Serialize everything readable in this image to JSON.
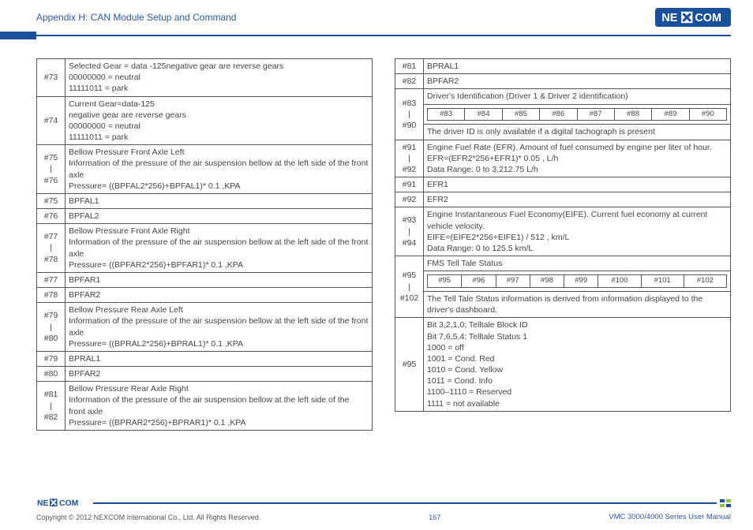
{
  "header": {
    "appendix": "Appendix H: CAN Module Setup and Command",
    "brand": "NEXCOM"
  },
  "left_rows": [
    {
      "idx": "#73",
      "desc": "Selected Gear = data -125negative gear are reverse gears\n00000000 = neutral\n11111011 = park"
    },
    {
      "idx": "#74",
      "desc": "Current Gear=data-125\nnegative gear are reverse gears\n00000000 = neutral\n11111011 = park"
    },
    {
      "idx": "#75\n|\n#76",
      "desc": "Bellow Pressure Front Axle Left\nInformation of the pressure of the air suspension bellow at the left side of the front axle\nPressure= ((BPFAL2*256)+BPFAL1)* 0.1 ,KPA"
    },
    {
      "idx": "#75",
      "desc": "BPFAL1"
    },
    {
      "idx": "#76",
      "desc": "BPFAL2"
    },
    {
      "idx": "#77\n|\n#78",
      "desc": "Bellow Pressure Front Axle Right\nInformation of the pressure of the air suspension bellow at the left side of the front axle\nPressure= ((BPFAR2*256)+BPFAR1)* 0.1 ,KPA"
    },
    {
      "idx": "#77",
      "desc": "BPFAR1"
    },
    {
      "idx": "#78",
      "desc": "BPFAR2"
    },
    {
      "idx": "#79\n|\n#80",
      "desc": "Bellow Pressure Rear Axle Left\nInformation of the pressure of the air suspension bellow at the left side of the front axle\nPressure= ((BPRAL2*256)+BPRAL1)* 0.1 ,KPA"
    },
    {
      "idx": "#79",
      "desc": "BPRAL1"
    },
    {
      "idx": "#80",
      "desc": "BPFAR2"
    },
    {
      "idx": "#81\n|\n#82",
      "desc": "Bellow Pressure Rear Axle Right\nInformation of the pressure of the air suspension bellow at the left side of the\nfront axle\nPressure= ((BPRAR2*256)+BPRAR1)* 0.1 ,KPA"
    }
  ],
  "right_rows_a": [
    {
      "idx": "#81",
      "desc": "BPRAL1"
    },
    {
      "idx": "#82",
      "desc": "BPFAR2"
    }
  ],
  "r83_idx": "#83\n|\n#90",
  "r83_title": "Driver's Identification (Driver 1 & Driver 2 identification)",
  "r83_sub": [
    "#83",
    "#84",
    "#85",
    "#86",
    "#87",
    "#88",
    "#89",
    "#90"
  ],
  "r83_note": "The driver ID is only available if a digital tachograph is present",
  "right_rows_b": [
    {
      "idx": "#91\n|\n#92",
      "desc": "Engine Fuel Rate (EFR). Amount of fuel consumed by engine per liter of hour.\nEFR=(EFR2*256+EFR1)* 0.05 , L/h\nData Range: 0 to 3,212.75 L/h"
    },
    {
      "idx": "#91",
      "desc": "EFR1"
    },
    {
      "idx": "#92",
      "desc": "EFR2"
    },
    {
      "idx": "#93\n|\n#94",
      "desc": "Engine Instantaneous Fuel Economy(EIFE). Current fuel economy at current vehicle velocity.\nEIFE=(EIFE2*256+EIFE1) / 512 , km/L\nData Range: 0 to 125.5 km/L"
    }
  ],
  "r95_idx": "#95\n|\n#102",
  "r95_title": "FMS Tell Tale Status",
  "r95_sub": [
    "#95",
    "#96",
    "#97",
    "#98",
    "#99",
    "#100",
    "#101",
    "#102"
  ],
  "r95_note": "The Tell Tale Status information is derived from information displayed to the\ndriver's dashboard.",
  "right_rows_c": [
    {
      "idx": "#95",
      "desc": "Bit 3,2,1,0: Telltale Block ID\nBit 7,6,5,4: Telltale Status 1\n1000 = off\n1001 = Cond. Red\n1010 = Cond. Yellow\n1011 = Cond. Info\n1100–1110 = Reserved\n1111 = not available"
    }
  ],
  "footer": {
    "copyright": "Copyright © 2012 NEXCOM International Co., Ltd. All Rights Reserved.",
    "page": "167",
    "manual": "VMC 3000/4000 Series User Manual"
  }
}
